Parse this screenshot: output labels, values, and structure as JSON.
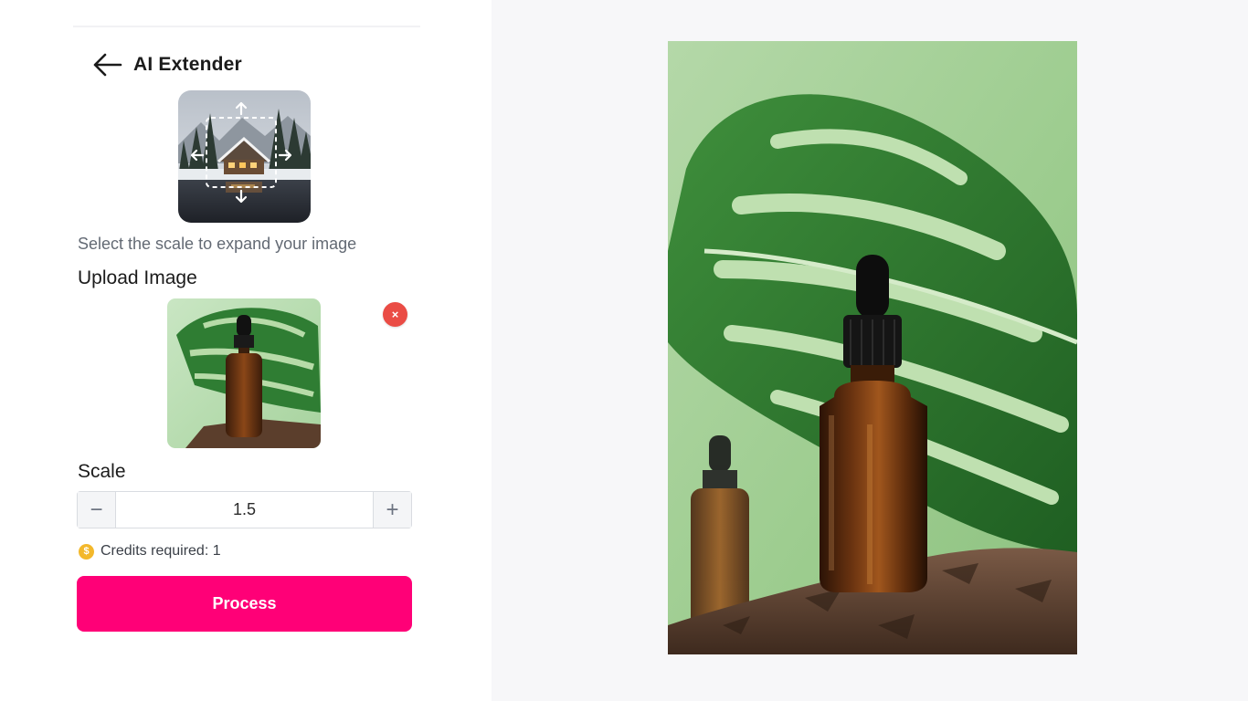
{
  "header": {
    "title": "AI Extender"
  },
  "intro": {
    "subtitle": "Select the scale to expand your image"
  },
  "upload": {
    "label": "Upload Image",
    "remove_label": "×"
  },
  "scale": {
    "label": "Scale",
    "value": "1.5",
    "decrement_label": "−",
    "increment_label": "+"
  },
  "credits": {
    "text": "Credits required: 1",
    "icon_glyph": "$"
  },
  "actions": {
    "process_label": "Process"
  },
  "icons": {
    "back": "arrow-left-icon",
    "remove": "close-icon",
    "coin": "coin-icon"
  },
  "colors": {
    "accent": "#ff0077",
    "remove": "#ea4c45",
    "coin": "#f3b82b",
    "subtitle": "#636a74"
  }
}
